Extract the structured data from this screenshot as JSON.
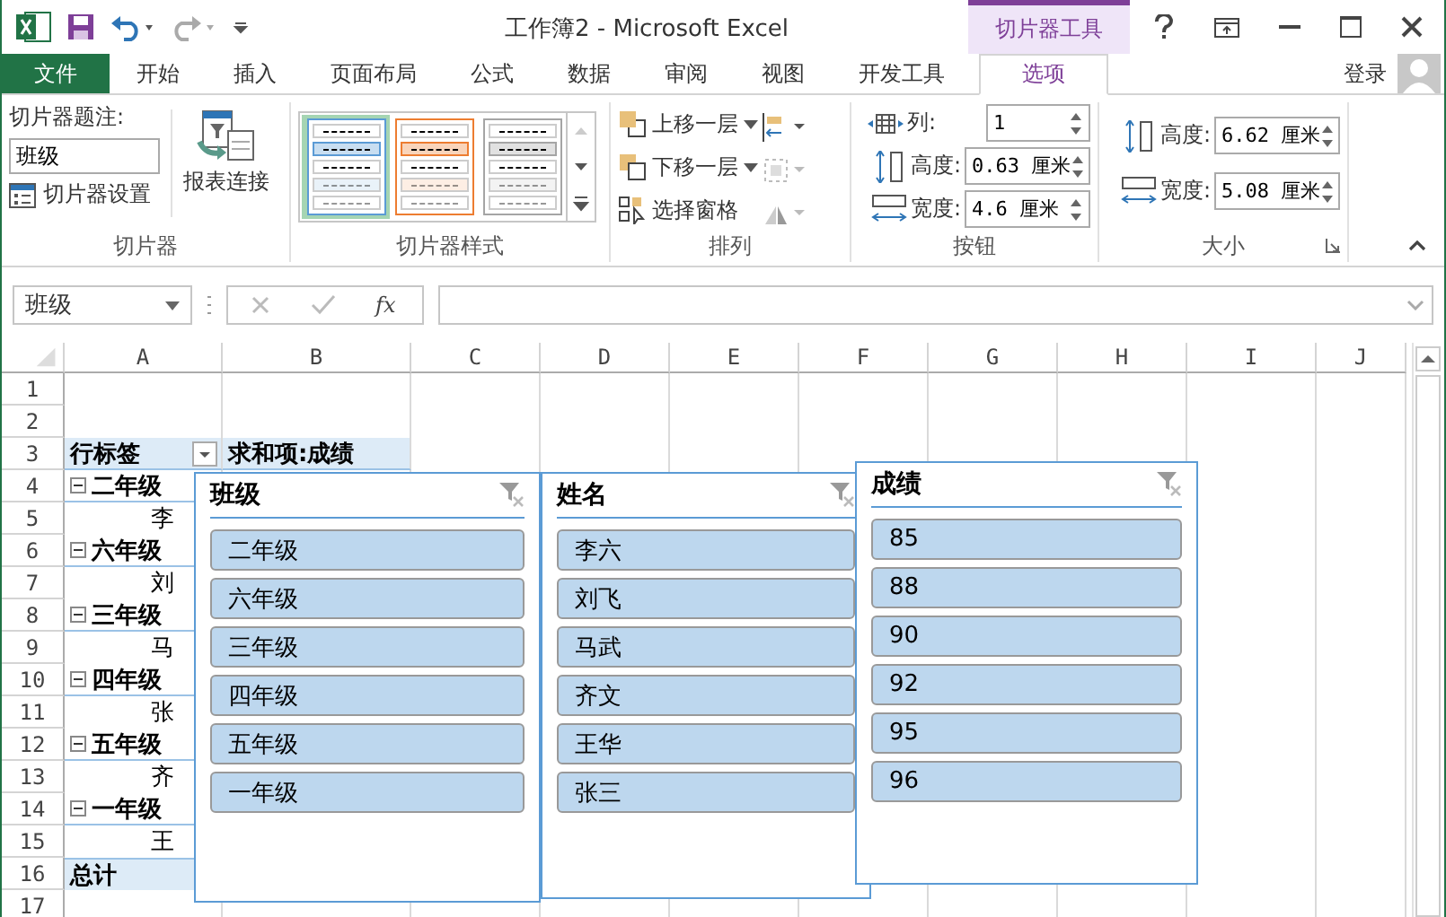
{
  "title_bar": {
    "title": "工作簿2 - Microsoft Excel",
    "context_group": "切片器工具"
  },
  "tabs": [
    {
      "label": "文件",
      "kind": "file",
      "selected": false
    },
    {
      "label": "开始",
      "kind": "tab",
      "selected": false
    },
    {
      "label": "插入",
      "kind": "tab",
      "selected": false
    },
    {
      "label": "页面布局",
      "kind": "tab",
      "selected": false
    },
    {
      "label": "公式",
      "kind": "tab",
      "selected": false
    },
    {
      "label": "数据",
      "kind": "tab",
      "selected": false
    },
    {
      "label": "审阅",
      "kind": "tab",
      "selected": false
    },
    {
      "label": "视图",
      "kind": "tab",
      "selected": false
    },
    {
      "label": "开发工具",
      "kind": "tab",
      "selected": false
    },
    {
      "label": "选项",
      "kind": "context",
      "selected": true
    }
  ],
  "sign_in": "登录",
  "ribbon": {
    "slicer_group": {
      "caption_label": "切片器题注:",
      "caption_value": "班级",
      "settings_button": "切片器设置",
      "report_button": "报表连接",
      "label": "切片器"
    },
    "styles_group": {
      "label": "切片器样式",
      "styles": [
        {
          "color": "#5b9bd5",
          "selected": true
        },
        {
          "color": "#ed7d31",
          "selected": false
        },
        {
          "color": "#a5a5a5",
          "selected": false
        }
      ]
    },
    "arrange_group": {
      "label": "排列",
      "bring_forward": "上移一层",
      "send_backward": "下移一层",
      "selection_pane": "选择窗格"
    },
    "buttons_group": {
      "label": "按钮",
      "columns_label": "列:",
      "columns_value": "1",
      "height_label": "高度:",
      "height_value": "0.63 厘米",
      "width_label": "宽度:",
      "width_value": "4.6 厘米"
    },
    "size_group": {
      "label": "大小",
      "height_label": "高度:",
      "height_value": "6.62 厘米",
      "width_label": "宽度:",
      "width_value": "5.08 厘米"
    }
  },
  "formula_bar": {
    "name_box": "班级",
    "fx_label": "fx"
  },
  "sheet": {
    "columns": [
      "A",
      "B",
      "C",
      "D",
      "E",
      "F",
      "G",
      "H",
      "I",
      "J"
    ],
    "rows": [
      "1",
      "2",
      "3",
      "4",
      "5",
      "6",
      "7",
      "8",
      "9",
      "10",
      "11",
      "12",
      "13",
      "14",
      "15",
      "16",
      "17"
    ],
    "pivot": {
      "row_label_header": "行标签",
      "value_header": "求和项:成绩",
      "total": "总计",
      "rows": [
        {
          "kind": "group",
          "text": "二年级",
          "expanded": true
        },
        {
          "kind": "item",
          "text": "李"
        },
        {
          "kind": "group",
          "text": "六年级",
          "expanded": true
        },
        {
          "kind": "item",
          "text": "刘"
        },
        {
          "kind": "group",
          "text": "三年级",
          "expanded": true
        },
        {
          "kind": "item",
          "text": "马"
        },
        {
          "kind": "group",
          "text": "四年级",
          "expanded": true
        },
        {
          "kind": "item",
          "text": "张"
        },
        {
          "kind": "group",
          "text": "五年级",
          "expanded": true
        },
        {
          "kind": "item",
          "text": "齐"
        },
        {
          "kind": "group",
          "text": "一年级",
          "expanded": true
        },
        {
          "kind": "item",
          "text": "王"
        }
      ]
    }
  },
  "slicers": [
    {
      "title": "班级",
      "items": [
        {
          "label": "二年级",
          "selected": true
        },
        {
          "label": "六年级",
          "selected": true
        },
        {
          "label": "三年级",
          "selected": true
        },
        {
          "label": "四年级",
          "selected": true
        },
        {
          "label": "五年级",
          "selected": true
        },
        {
          "label": "一年级",
          "selected": true
        }
      ]
    },
    {
      "title": "姓名",
      "items": [
        {
          "label": "李六",
          "selected": true
        },
        {
          "label": "刘飞",
          "selected": true
        },
        {
          "label": "马武",
          "selected": true
        },
        {
          "label": "齐文",
          "selected": true
        },
        {
          "label": "王华",
          "selected": true
        },
        {
          "label": "张三",
          "selected": true
        }
      ]
    },
    {
      "title": "成绩",
      "items": [
        {
          "label": "85",
          "selected": true
        },
        {
          "label": "88",
          "selected": true
        },
        {
          "label": "90",
          "selected": true
        },
        {
          "label": "92",
          "selected": true
        },
        {
          "label": "95",
          "selected": true
        },
        {
          "label": "96",
          "selected": true
        }
      ]
    }
  ]
}
